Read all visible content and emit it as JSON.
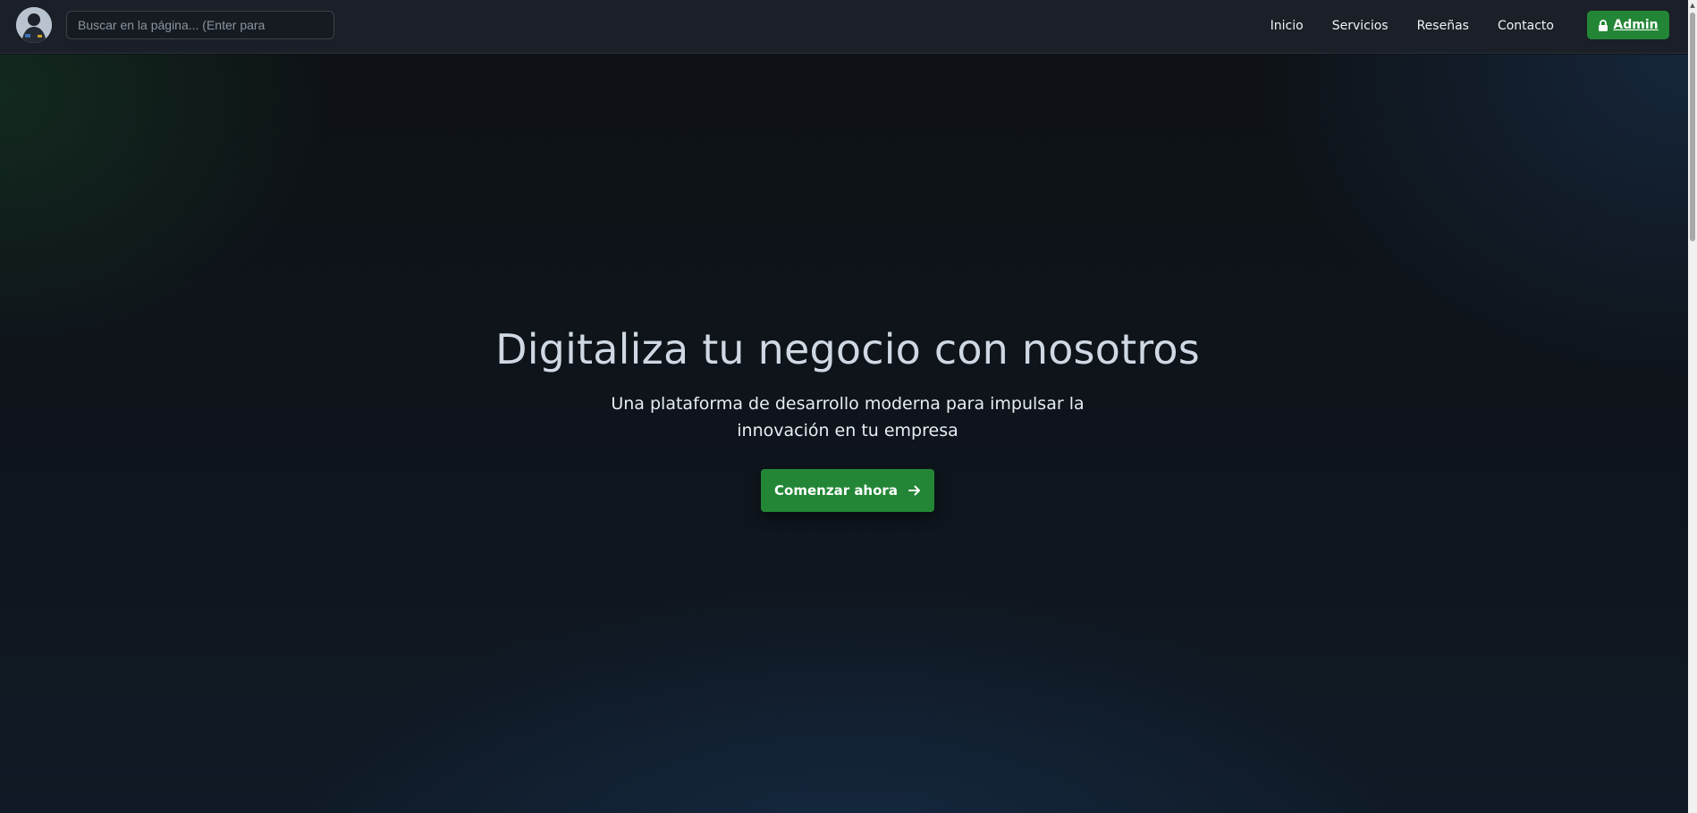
{
  "navbar": {
    "avatar_alt": "avatar",
    "search_placeholder": "Buscar en la página... (Enter para",
    "links": [
      {
        "label": "Inicio"
      },
      {
        "label": "Servicios"
      },
      {
        "label": "Reseñas"
      },
      {
        "label": "Contacto"
      }
    ],
    "admin_label": "Admin",
    "admin_icon": "lock-icon"
  },
  "hero": {
    "title": "Digitaliza tu negocio con nosotros",
    "subtitle": "Una plataforma de desarrollo moderna para impulsar la innovación en tu empresa",
    "cta_label": "Comenzar ahora",
    "cta_icon": "arrow-right-icon"
  },
  "colors": {
    "accent_green": "#238636",
    "navbar_bg": "#1b1f27",
    "hero_bg": "#0f151d",
    "title_text": "#cfd8e3"
  }
}
